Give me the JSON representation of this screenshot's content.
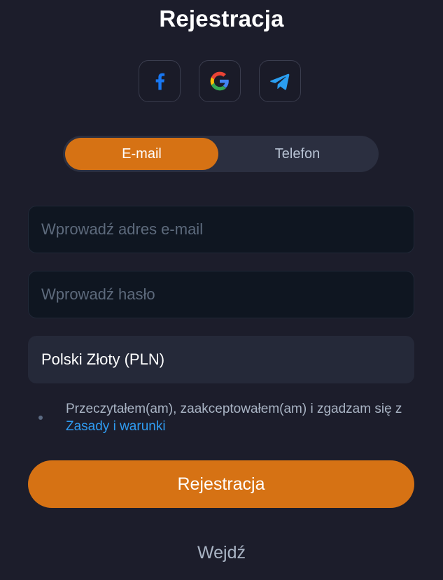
{
  "title": "Rejestracja",
  "social": {
    "facebook_icon": "facebook-icon",
    "google_icon": "google-icon",
    "telegram_icon": "telegram-icon",
    "facebook_color": "#1877f2",
    "telegram_color": "#2a9ef1"
  },
  "tabs": [
    {
      "label": "E-mail",
      "active": true
    },
    {
      "label": "Telefon",
      "active": false
    }
  ],
  "form": {
    "email_placeholder": "Wprowadź adres e-mail",
    "email_value": "",
    "password_placeholder": "Wprowadź hasło",
    "password_value": "",
    "currency_value": "Polski Złoty (PLN)"
  },
  "terms": {
    "text": "Przeczytałem(am), zaakceptowałem(am) i zgadzam się z ",
    "link": "Zasady i warunki"
  },
  "submit_label": "Rejestracja",
  "login_label": "Wejdź",
  "colors": {
    "accent": "#d67214",
    "background": "#1c1d2b",
    "link": "#2f9bf0"
  }
}
